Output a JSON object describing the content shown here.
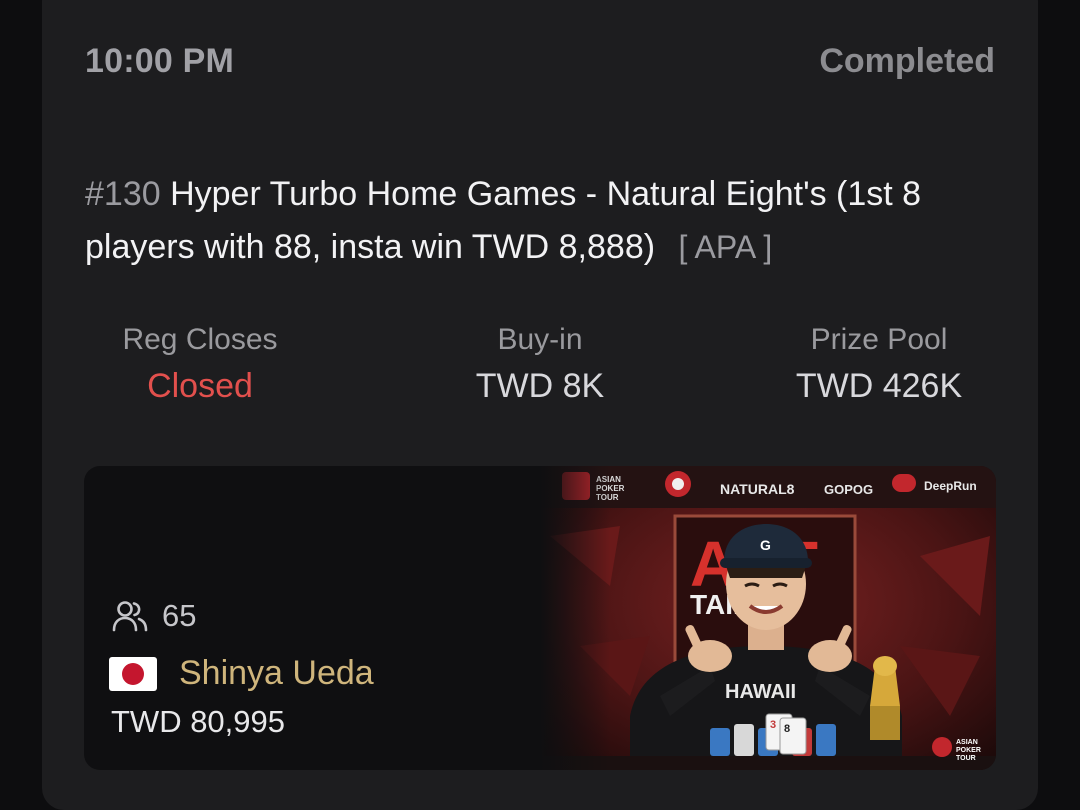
{
  "header": {
    "time": "10:00 PM",
    "status": "Completed"
  },
  "event": {
    "number": "#130",
    "title": "Hyper Turbo Home Games - Natural Eight's (1st 8 players with 88, insta win TWD 8,888)",
    "tag": "[ APA ]"
  },
  "stats": [
    {
      "label": "Reg Closes",
      "value": "Closed"
    },
    {
      "label": "Buy-in",
      "value": "TWD 8K"
    },
    {
      "label": "Prize Pool",
      "value": "TWD 426K"
    }
  ],
  "winner": {
    "entries": "65",
    "name": "Shinya Ueda",
    "prize": "TWD 80,995",
    "flag": "japan-flag",
    "photo_logos": [
      "ASIAN POKER TOUR",
      "NATURAL8",
      "DeepRun"
    ],
    "cap_letter": "G",
    "shirt_text": "HAWAII"
  },
  "colors": {
    "background": "#0d0d0f",
    "card": "#1d1d1f",
    "closed": "#e2504d",
    "winner_name": "#cfb57c"
  }
}
